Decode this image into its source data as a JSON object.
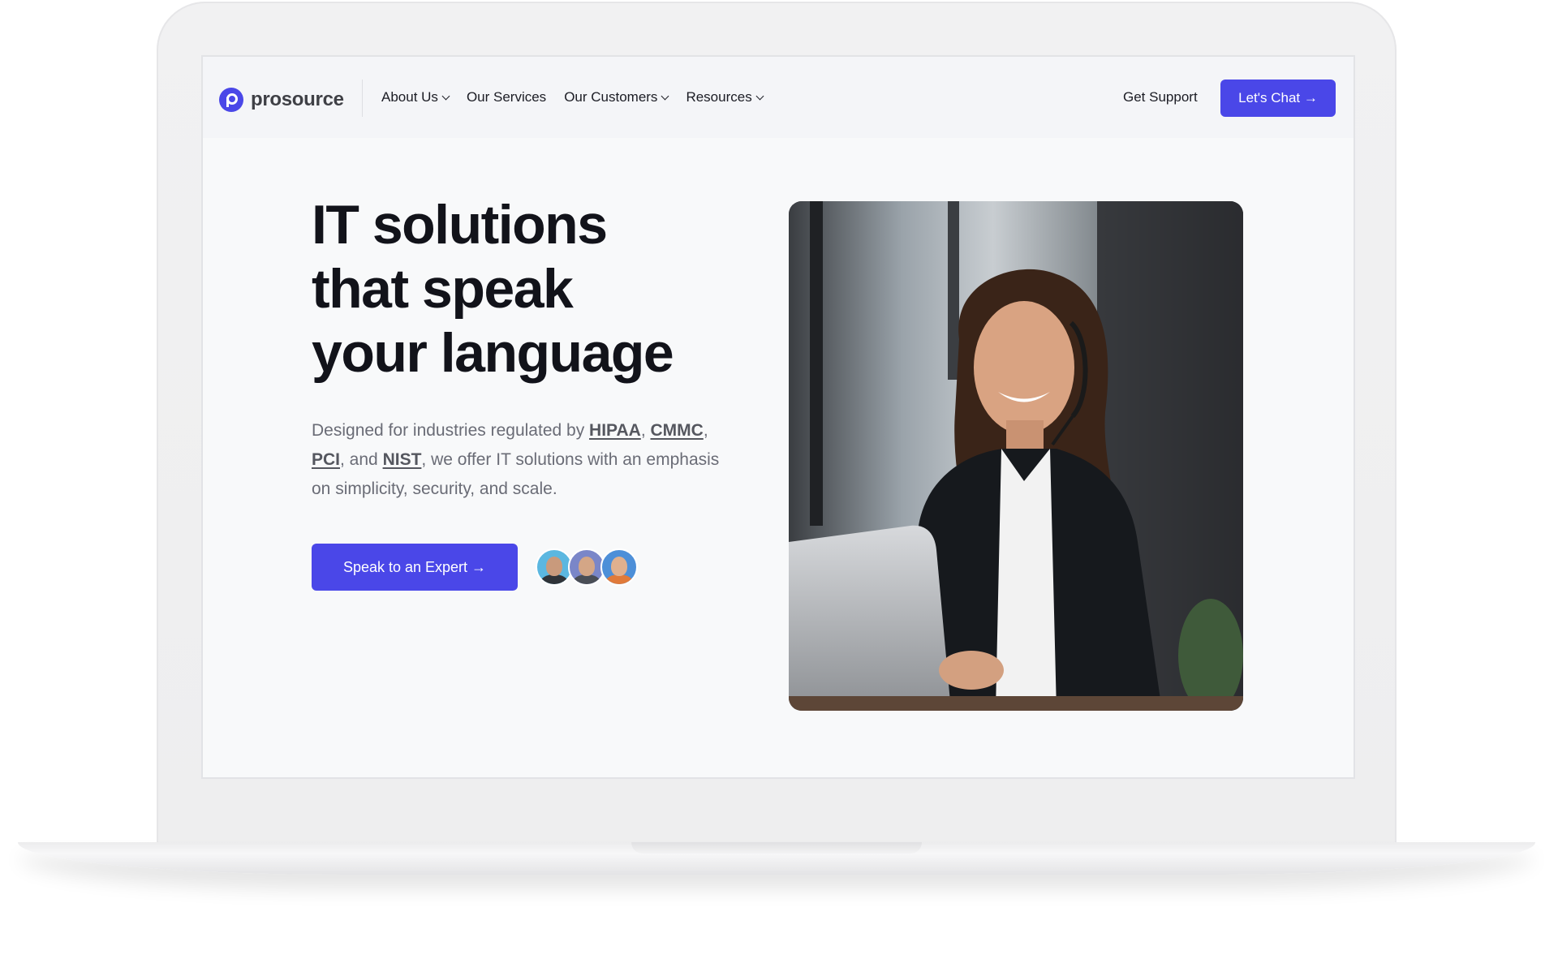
{
  "brand": {
    "name": "prosource",
    "accent_color": "#4a47e8"
  },
  "nav": {
    "items": [
      {
        "label": "About Us",
        "has_dropdown": true
      },
      {
        "label": "Our Services",
        "has_dropdown": false
      },
      {
        "label": "Our Customers",
        "has_dropdown": true
      },
      {
        "label": "Resources",
        "has_dropdown": true
      }
    ],
    "support_label": "Get Support",
    "chat_label": "Let's Chat →"
  },
  "hero": {
    "headline_lines": [
      "IT solutions",
      "that speak",
      "your language"
    ],
    "desc": {
      "t1": "Designed for industries regulated by ",
      "link1": "HIPAA",
      "t2": ", ",
      "link2": "CMMC",
      "t3": ", ",
      "link3": "PCI",
      "t4": ", and ",
      "link4": "NIST",
      "t5": ", we offer IT solutions with an emphasis on simplicity, security, and scale."
    },
    "cta_label": "Speak to an Expert →",
    "avatar_count": 3
  },
  "icons": {
    "logo": "prosource-logo-icon",
    "chevron": "chevron-down-icon"
  }
}
